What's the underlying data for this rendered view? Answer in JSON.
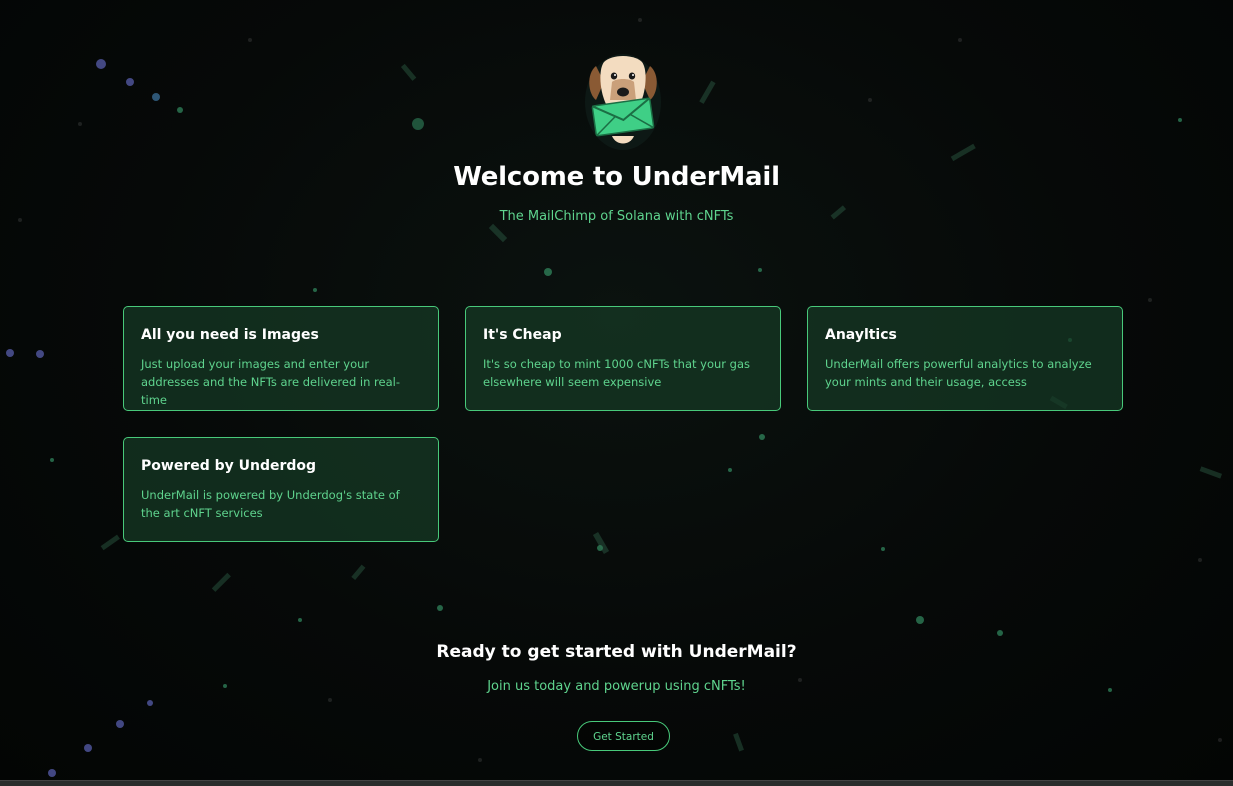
{
  "header": {
    "title": "Welcome to UnderMail",
    "subtitle": "The MailChimp of Solana with cNFTs",
    "logo_icon": "dog-with-envelope-logo"
  },
  "features": [
    {
      "title": "All you need is Images",
      "text": "Just upload your images and enter your addresses and the NFTs are delivered in real-time"
    },
    {
      "title": "It's Cheap",
      "text": "It's so cheap to mint 1000 cNFTs that your gas elsewhere will seem expensive"
    },
    {
      "title": "Anayltics",
      "text": "UnderMail offers powerful analytics to analyze your mints and their usage, access"
    },
    {
      "title": "Powered by Underdog",
      "text": "UnderMail is powered by Underdog's state of the art cNFT services"
    }
  ],
  "cta": {
    "title": "Ready to get started with UnderMail?",
    "subtitle": "Join us today and powerup using cNFTs!",
    "button_label": "Get Started"
  },
  "colors": {
    "accent_green": "#5fd48e",
    "card_border": "#48c97a",
    "card_bg": "#163a26",
    "background": "#050807"
  }
}
